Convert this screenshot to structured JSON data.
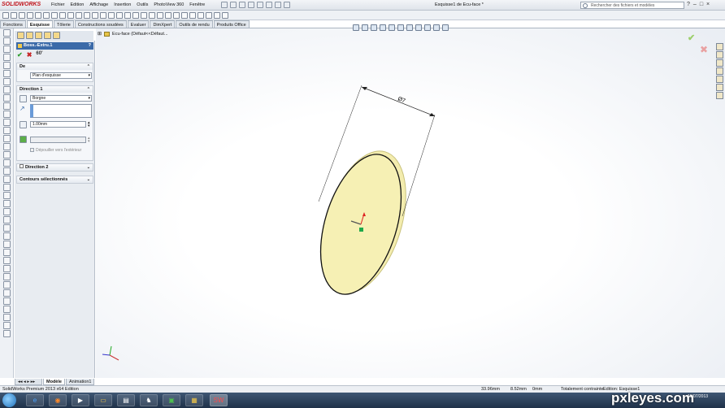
{
  "app": {
    "logo": "SOLIDWORKS",
    "doc_title": "Esquisse1 de Ecu-face *"
  },
  "menu": [
    "Fichier",
    "Edition",
    "Affichage",
    "Insertion",
    "Outils",
    "PhotoView 360",
    "Fenêtre"
  ],
  "search": {
    "placeholder": "Rechercher des fichiers et modèles"
  },
  "window_buttons": [
    "?",
    "–",
    "□",
    "×"
  ],
  "tabs": [
    "Fonctions",
    "Esquisse",
    "Tôlerie",
    "Constructions soudées",
    "Evaluer",
    "DimXpert",
    "Outils de rendu",
    "Produits Office"
  ],
  "active_tab": "Esquisse",
  "tree": {
    "label": "Ecu-face  (Défaut<<Défaut..."
  },
  "property_manager": {
    "title": "Boss.-Extru.1",
    "help": "?",
    "ok": "✔",
    "cancel": "✖",
    "detail": "60'",
    "from": {
      "label": "De",
      "value": "Plan d'esquisse"
    },
    "direction1": {
      "label": "Direction 1",
      "type": "Borgne",
      "depth": "1.00mm",
      "draft_label": "Dépouiller vers l'extérieur"
    },
    "direction2": {
      "label": "Direction 2"
    },
    "contours": {
      "label": "Contours sélectionnés"
    }
  },
  "dimension": {
    "label": "Ø7"
  },
  "bottom_tabs": [
    "Modèle",
    "Animation1"
  ],
  "status": {
    "edition": "SolidWorks Premium 2013 x64 Edition",
    "x": "33.96mm",
    "y": "8.52mm",
    "z": "0mm",
    "constraint": "Totalement contrainte",
    "edit": "Edition: Esquisse1"
  },
  "taskbar": {
    "watermark": "pxleyes.com",
    "date": "19/07/2013"
  },
  "colors": {
    "part_fill": "#f6f0b4",
    "accent": "#3b6aa8"
  }
}
